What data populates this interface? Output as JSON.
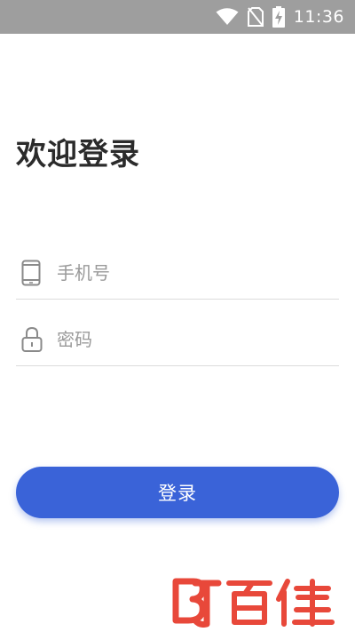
{
  "status_bar": {
    "time": "11:36",
    "background_color": "#9e9e9e",
    "icons": [
      "wifi-icon",
      "no-sim-icon",
      "battery-charging-icon"
    ]
  },
  "login": {
    "title": "欢迎登录",
    "phone_placeholder": "手机号",
    "phone_value": "",
    "password_placeholder": "密码",
    "password_value": "",
    "submit_label": "登录"
  },
  "watermark": {
    "text": "百佳",
    "mark": "B",
    "color": "#e8483a"
  },
  "colors": {
    "accent": "#3a63d8",
    "divider": "#dcdcdc",
    "title": "#2b2b2b",
    "placeholder": "#9a9a9a"
  }
}
